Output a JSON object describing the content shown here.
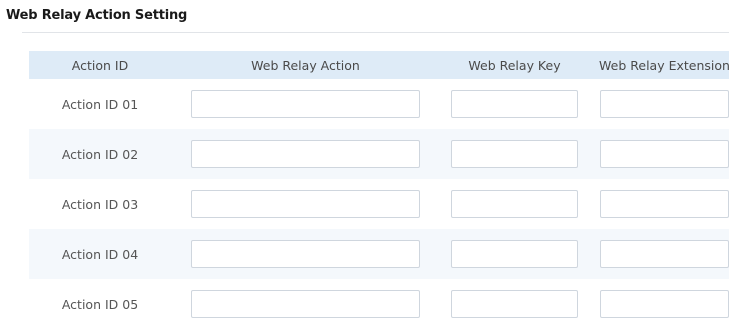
{
  "section": {
    "title": "Web Relay Action Setting"
  },
  "table": {
    "headers": {
      "action_id": "Action ID",
      "web_relay_action": "Web Relay Action",
      "web_relay_key": "Web Relay Key",
      "web_relay_extension": "Web Relay Extension"
    },
    "rows": [
      {
        "action_id": "Action ID 01",
        "web_relay_action": "",
        "web_relay_key": "",
        "web_relay_extension": ""
      },
      {
        "action_id": "Action ID 02",
        "web_relay_action": "",
        "web_relay_key": "",
        "web_relay_extension": ""
      },
      {
        "action_id": "Action ID 03",
        "web_relay_action": "",
        "web_relay_key": "",
        "web_relay_extension": ""
      },
      {
        "action_id": "Action ID 04",
        "web_relay_action": "",
        "web_relay_key": "",
        "web_relay_extension": ""
      },
      {
        "action_id": "Action ID 05",
        "web_relay_action": "",
        "web_relay_key": "",
        "web_relay_extension": ""
      }
    ]
  },
  "colors": {
    "header_background": "#deebf7",
    "shaded_row_background": "#f4f8fc",
    "input_border": "#cfd6de"
  }
}
